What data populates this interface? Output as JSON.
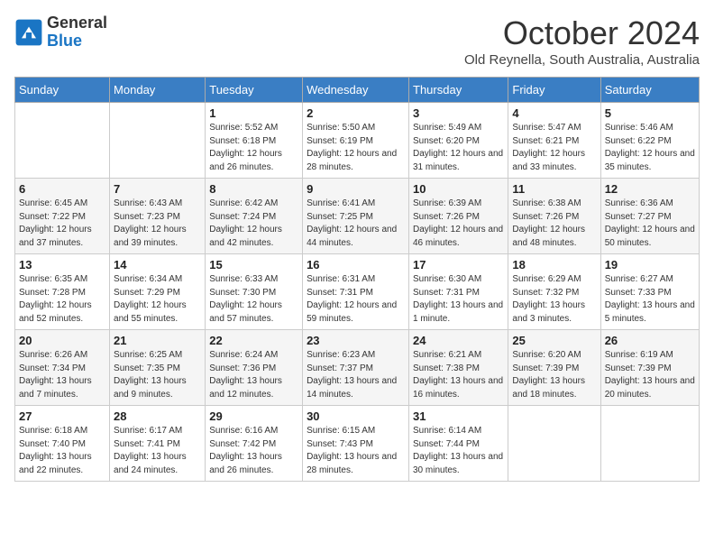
{
  "header": {
    "logo_line1": "General",
    "logo_line2": "Blue",
    "month_title": "October 2024",
    "location": "Old Reynella, South Australia, Australia"
  },
  "days_of_week": [
    "Sunday",
    "Monday",
    "Tuesday",
    "Wednesday",
    "Thursday",
    "Friday",
    "Saturday"
  ],
  "weeks": [
    [
      {
        "day": null
      },
      {
        "day": null
      },
      {
        "day": "1",
        "sunrise": "5:52 AM",
        "sunset": "6:18 PM",
        "daylight": "12 hours and 26 minutes."
      },
      {
        "day": "2",
        "sunrise": "5:50 AM",
        "sunset": "6:19 PM",
        "daylight": "12 hours and 28 minutes."
      },
      {
        "day": "3",
        "sunrise": "5:49 AM",
        "sunset": "6:20 PM",
        "daylight": "12 hours and 31 minutes."
      },
      {
        "day": "4",
        "sunrise": "5:47 AM",
        "sunset": "6:21 PM",
        "daylight": "12 hours and 33 minutes."
      },
      {
        "day": "5",
        "sunrise": "5:46 AM",
        "sunset": "6:22 PM",
        "daylight": "12 hours and 35 minutes."
      }
    ],
    [
      {
        "day": "6",
        "sunrise": "6:45 AM",
        "sunset": "7:22 PM",
        "daylight": "12 hours and 37 minutes."
      },
      {
        "day": "7",
        "sunrise": "6:43 AM",
        "sunset": "7:23 PM",
        "daylight": "12 hours and 39 minutes."
      },
      {
        "day": "8",
        "sunrise": "6:42 AM",
        "sunset": "7:24 PM",
        "daylight": "12 hours and 42 minutes."
      },
      {
        "day": "9",
        "sunrise": "6:41 AM",
        "sunset": "7:25 PM",
        "daylight": "12 hours and 44 minutes."
      },
      {
        "day": "10",
        "sunrise": "6:39 AM",
        "sunset": "7:26 PM",
        "daylight": "12 hours and 46 minutes."
      },
      {
        "day": "11",
        "sunrise": "6:38 AM",
        "sunset": "7:26 PM",
        "daylight": "12 hours and 48 minutes."
      },
      {
        "day": "12",
        "sunrise": "6:36 AM",
        "sunset": "7:27 PM",
        "daylight": "12 hours and 50 minutes."
      }
    ],
    [
      {
        "day": "13",
        "sunrise": "6:35 AM",
        "sunset": "7:28 PM",
        "daylight": "12 hours and 52 minutes."
      },
      {
        "day": "14",
        "sunrise": "6:34 AM",
        "sunset": "7:29 PM",
        "daylight": "12 hours and 55 minutes."
      },
      {
        "day": "15",
        "sunrise": "6:33 AM",
        "sunset": "7:30 PM",
        "daylight": "12 hours and 57 minutes."
      },
      {
        "day": "16",
        "sunrise": "6:31 AM",
        "sunset": "7:31 PM",
        "daylight": "12 hours and 59 minutes."
      },
      {
        "day": "17",
        "sunrise": "6:30 AM",
        "sunset": "7:31 PM",
        "daylight": "13 hours and 1 minute."
      },
      {
        "day": "18",
        "sunrise": "6:29 AM",
        "sunset": "7:32 PM",
        "daylight": "13 hours and 3 minutes."
      },
      {
        "day": "19",
        "sunrise": "6:27 AM",
        "sunset": "7:33 PM",
        "daylight": "13 hours and 5 minutes."
      }
    ],
    [
      {
        "day": "20",
        "sunrise": "6:26 AM",
        "sunset": "7:34 PM",
        "daylight": "13 hours and 7 minutes."
      },
      {
        "day": "21",
        "sunrise": "6:25 AM",
        "sunset": "7:35 PM",
        "daylight": "13 hours and 9 minutes."
      },
      {
        "day": "22",
        "sunrise": "6:24 AM",
        "sunset": "7:36 PM",
        "daylight": "13 hours and 12 minutes."
      },
      {
        "day": "23",
        "sunrise": "6:23 AM",
        "sunset": "7:37 PM",
        "daylight": "13 hours and 14 minutes."
      },
      {
        "day": "24",
        "sunrise": "6:21 AM",
        "sunset": "7:38 PM",
        "daylight": "13 hours and 16 minutes."
      },
      {
        "day": "25",
        "sunrise": "6:20 AM",
        "sunset": "7:39 PM",
        "daylight": "13 hours and 18 minutes."
      },
      {
        "day": "26",
        "sunrise": "6:19 AM",
        "sunset": "7:39 PM",
        "daylight": "13 hours and 20 minutes."
      }
    ],
    [
      {
        "day": "27",
        "sunrise": "6:18 AM",
        "sunset": "7:40 PM",
        "daylight": "13 hours and 22 minutes."
      },
      {
        "day": "28",
        "sunrise": "6:17 AM",
        "sunset": "7:41 PM",
        "daylight": "13 hours and 24 minutes."
      },
      {
        "day": "29",
        "sunrise": "6:16 AM",
        "sunset": "7:42 PM",
        "daylight": "13 hours and 26 minutes."
      },
      {
        "day": "30",
        "sunrise": "6:15 AM",
        "sunset": "7:43 PM",
        "daylight": "13 hours and 28 minutes."
      },
      {
        "day": "31",
        "sunrise": "6:14 AM",
        "sunset": "7:44 PM",
        "daylight": "13 hours and 30 minutes."
      },
      {
        "day": null
      },
      {
        "day": null
      }
    ]
  ]
}
